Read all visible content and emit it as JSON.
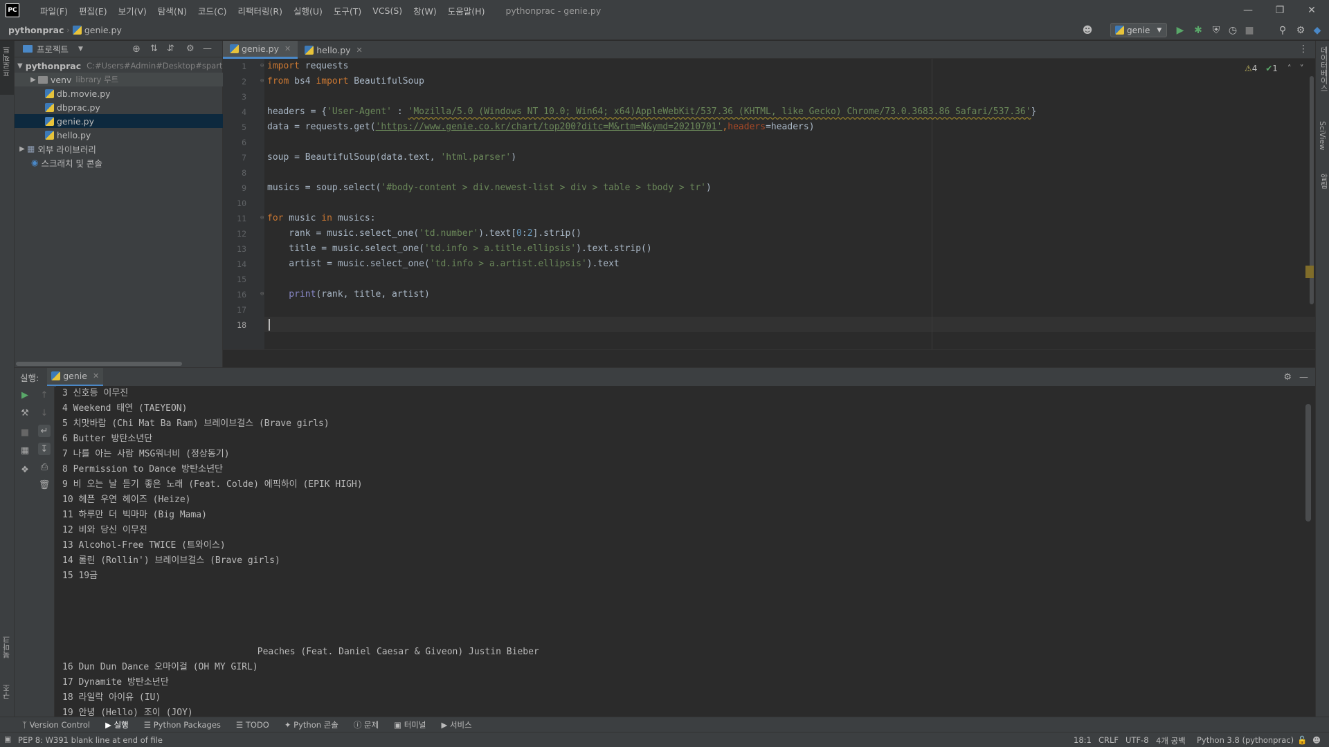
{
  "app": {
    "logo": "PC",
    "window_title": "pythonprac - genie.py"
  },
  "menu": [
    "파일(F)",
    "편집(E)",
    "보기(V)",
    "탐색(N)",
    "코드(C)",
    "리팩터링(R)",
    "실행(U)",
    "도구(T)",
    "VCS(S)",
    "창(W)",
    "도움말(H)"
  ],
  "navbar": {
    "project": "pythonprac",
    "file": "genie.py",
    "run_config": "genie"
  },
  "project_panel": {
    "title": "프로젝트",
    "root": {
      "name": "pythonprac",
      "path": "C:#Users#Admin#Desktop#sparta"
    },
    "venv": {
      "name": "venv",
      "note": "library 루트"
    },
    "files": [
      "db.movie.py",
      "dbprac.py",
      "genie.py",
      "hello.py"
    ],
    "external_libs": "외부 라이브러리",
    "scratches": "스크래치 및 콘솔"
  },
  "left_strip": {
    "project_label": "프로젝트",
    "bookmarks_label": "북마크",
    "structure_label": "구조"
  },
  "right_strip": {
    "database_label": "데이터베이스",
    "sciview_label": "SciView",
    "notifications_label": "알림"
  },
  "editor": {
    "tabs": [
      {
        "label": "genie.py",
        "active": true
      },
      {
        "label": "hello.py",
        "active": false
      }
    ],
    "inspections": {
      "warnings": "4",
      "checks": "1"
    },
    "line_numbers": [
      "1",
      "2",
      "3",
      "4",
      "5",
      "6",
      "7",
      "8",
      "9",
      "10",
      "11",
      "12",
      "13",
      "14",
      "15",
      "16",
      "17",
      "18"
    ],
    "current_line": 18
  },
  "code": {
    "l1": {
      "kw": "import",
      "rest": " requests"
    },
    "l2": {
      "kw1": "from",
      "mid": " bs4 ",
      "kw2": "import",
      "rest": " BeautifulSoup"
    },
    "l4": {
      "a": "headers = {",
      "key": "'User-Agent'",
      "b": " : ",
      "val": "'Mozilla/5.0 (Windows NT 10.0; Win64; x64)AppleWebKit/537.36 (KHTML, like Gecko) Chrome/73.0.3683.86 Safari/537.36'",
      "c": "}"
    },
    "l5": {
      "a": "data = requests.get(",
      "url": "'https://www.genie.co.kr/chart/top200?ditc=M&rtm=N&ymd=20210701'",
      "comma": ",",
      "param": "headers",
      "b": "=headers)"
    },
    "l7": {
      "a": "soup = BeautifulSoup(data.text, ",
      "s": "'html.parser'",
      "b": ")"
    },
    "l9": {
      "a": "musics = soup.select(",
      "s": "'#body-content > div.newest-list > div > table > tbody > tr'",
      "b": ")"
    },
    "l11": {
      "kw1": "for",
      "mid": " music ",
      "kw2": "in",
      "rest": " musics:"
    },
    "l12": {
      "a": "    rank = music.select_one(",
      "s": "'td.number'",
      "b": ").text[",
      "n1": "0",
      "c": ":",
      "n2": "2",
      "d": "].strip()"
    },
    "l13": {
      "a": "    title = music.select_one(",
      "s": "'td.info > a.title.ellipsis'",
      "b": ").text.strip()"
    },
    "l14": {
      "a": "    artist = music.select_one(",
      "s": "'td.info > a.artist.ellipsis'",
      "b": ").text"
    },
    "l16": {
      "fn": "    print",
      "rest": "(rank, title, artist)"
    }
  },
  "run_panel": {
    "label": "실행:",
    "tab": "genie",
    "output": [
      "3 신호등 이무진",
      "4 Weekend 태연 (TAEYEON)",
      "5 치맛바람 (Chi Mat Ba Ram) 브레이브걸스 (Brave girls)",
      "6 Butter 방탄소년단",
      "7 나를 아는 사람 MSG워너비 (정상동기)",
      "8 Permission to Dance 방탄소년단",
      "9 비 오는 날 듣기 좋은 노래 (Feat. Colde) 에픽하이 (EPIK HIGH)",
      "10 헤픈 우연 헤이즈 (Heize)",
      "11 하루만 더 빅마마 (Big Mama)",
      "12 비와 당신 이무진",
      "13 Alcohol-Free TWICE (트와이스)",
      "14 롤린 (Rollin') 브레이브걸스 (Brave girls)",
      "15 19금",
      "",
      "",
      "",
      "",
      "                                    Peaches (Feat. Daniel Caesar & Giveon) Justin Bieber",
      "16 Dun Dun Dance 오마이걸 (OH MY GIRL)",
      "17 Dynamite 방탄소년단",
      "18 라일락 아이유 (IU)",
      "19 안녕 (Hello) 조이 (JOY)"
    ]
  },
  "tool_windows": [
    "Version Control",
    "실행",
    "Python Packages",
    "TODO",
    "Python 콘솔",
    "문제",
    "터미널",
    "서비스"
  ],
  "status": {
    "message": "PEP 8: W391 blank line at end of file",
    "position": "18:1",
    "line_sep": "CRLF",
    "encoding": "UTF-8",
    "indent": "4개 공백",
    "interpreter": "Python 3.8 (pythonprac)"
  },
  "colors": {
    "keyword": "#cc7832",
    "string": "#6a8759",
    "number": "#6897bb",
    "param": "#aa4926",
    "accent": "#4a88c7",
    "selection": "#0d293e"
  }
}
